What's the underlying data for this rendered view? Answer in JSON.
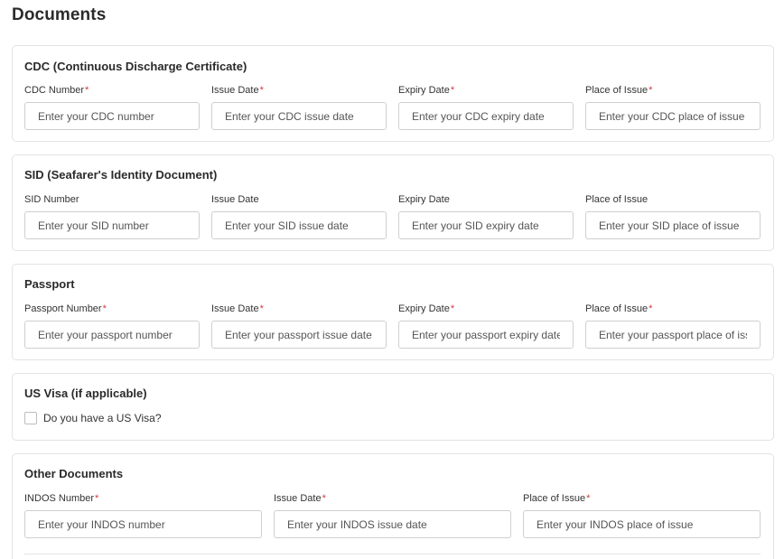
{
  "page": {
    "title": "Documents"
  },
  "sections": {
    "cdc": {
      "title": "CDC (Continuous Discharge Certificate)",
      "fields": [
        {
          "label": "CDC Number",
          "required": "*",
          "placeholder": "Enter your CDC number",
          "value": ""
        },
        {
          "label": "Issue Date",
          "required": "*",
          "placeholder": "Enter your CDC issue date",
          "value": ""
        },
        {
          "label": "Expiry Date",
          "required": "*",
          "placeholder": "Enter your CDC expiry date",
          "value": ""
        },
        {
          "label": "Place of Issue",
          "required": "*",
          "placeholder": "Enter your CDC place of issue",
          "value": ""
        }
      ]
    },
    "sid": {
      "title": "SID (Seafarer's Identity Document)",
      "fields": [
        {
          "label": "SID Number",
          "required": "",
          "placeholder": "Enter your SID number",
          "value": ""
        },
        {
          "label": "Issue Date",
          "required": "",
          "placeholder": "Enter your SID issue date",
          "value": ""
        },
        {
          "label": "Expiry Date",
          "required": "",
          "placeholder": "Enter your SID expiry date",
          "value": ""
        },
        {
          "label": "Place of Issue",
          "required": "",
          "placeholder": "Enter your SID place of issue",
          "value": ""
        }
      ]
    },
    "passport": {
      "title": "Passport",
      "fields": [
        {
          "label": "Passport Number",
          "required": "*",
          "placeholder": "Enter your passport number",
          "value": ""
        },
        {
          "label": "Issue Date",
          "required": "*",
          "placeholder": "Enter your passport issue date",
          "value": ""
        },
        {
          "label": "Expiry Date",
          "required": "*",
          "placeholder": "Enter your passport expiry date",
          "value": ""
        },
        {
          "label": "Place of Issue",
          "required": "*",
          "placeholder": "Enter your passport place of issue",
          "value": ""
        }
      ]
    },
    "us_visa": {
      "title": "US Visa (if applicable)",
      "checkbox_label": "Do you have a US Visa?",
      "checked": false
    },
    "other": {
      "title": "Other Documents",
      "fields": [
        {
          "label": "INDOS Number",
          "required": "*",
          "placeholder": "Enter your INDOS number",
          "value": ""
        },
        {
          "label": "Issue Date",
          "required": "*",
          "placeholder": "Enter your INDOS issue date",
          "value": ""
        },
        {
          "label": "Place of Issue",
          "required": "*",
          "placeholder": "Enter your INDOS place of issue",
          "value": ""
        }
      ]
    }
  },
  "colors": {
    "required_marker": "#d9363e",
    "border": "#e3e3e3",
    "input_border": "#cfcfcf"
  }
}
